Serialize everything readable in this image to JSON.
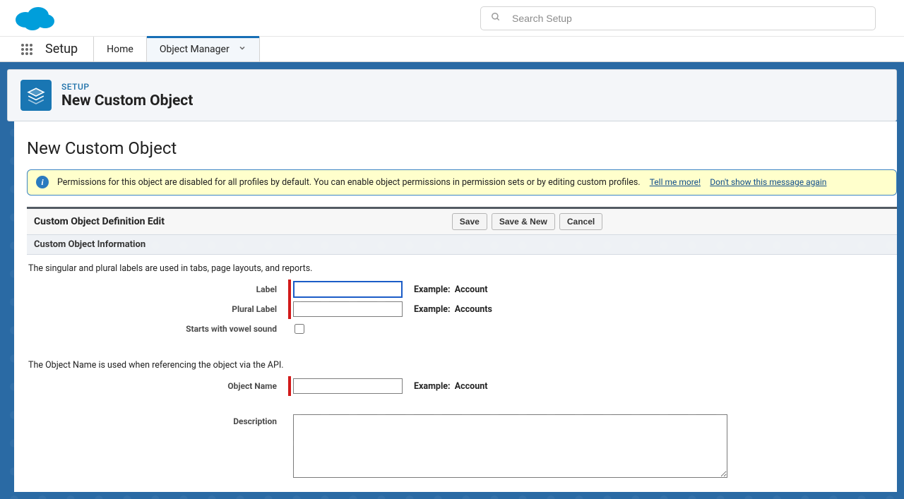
{
  "search": {
    "placeholder": "Search Setup"
  },
  "nav": {
    "app_name": "Setup",
    "tabs": [
      {
        "label": "Home",
        "active": false
      },
      {
        "label": "Object Manager",
        "active": true
      }
    ]
  },
  "breadcrumb": {
    "kicker": "SETUP",
    "title": "New Custom Object"
  },
  "page": {
    "title": "New Custom Object"
  },
  "banner": {
    "text": "Permissions for this object are disabled for all profiles by default. You can enable object permissions in permission sets or by editing custom profiles.",
    "link_more": "Tell me more!",
    "link_hide": "Don't show this message again"
  },
  "section": {
    "edit_title": "Custom Object Definition Edit",
    "buttons": {
      "save": "Save",
      "save_new": "Save & New",
      "cancel": "Cancel"
    },
    "info_title": "Custom Object Information"
  },
  "form": {
    "help1": "The singular and plural labels are used in tabs, page layouts, and reports.",
    "help2": "The Object Name is used when referencing the object via the API.",
    "labels": {
      "label": "Label",
      "plural": "Plural Label",
      "vowel": "Starts with vowel sound",
      "object_name": "Object Name",
      "description": "Description"
    },
    "examples": {
      "prefix": "Example:",
      "label": "Account",
      "plural": "Accounts",
      "object_name": "Account"
    },
    "values": {
      "label": "",
      "plural": "",
      "vowel": false,
      "object_name": "",
      "description": ""
    }
  }
}
